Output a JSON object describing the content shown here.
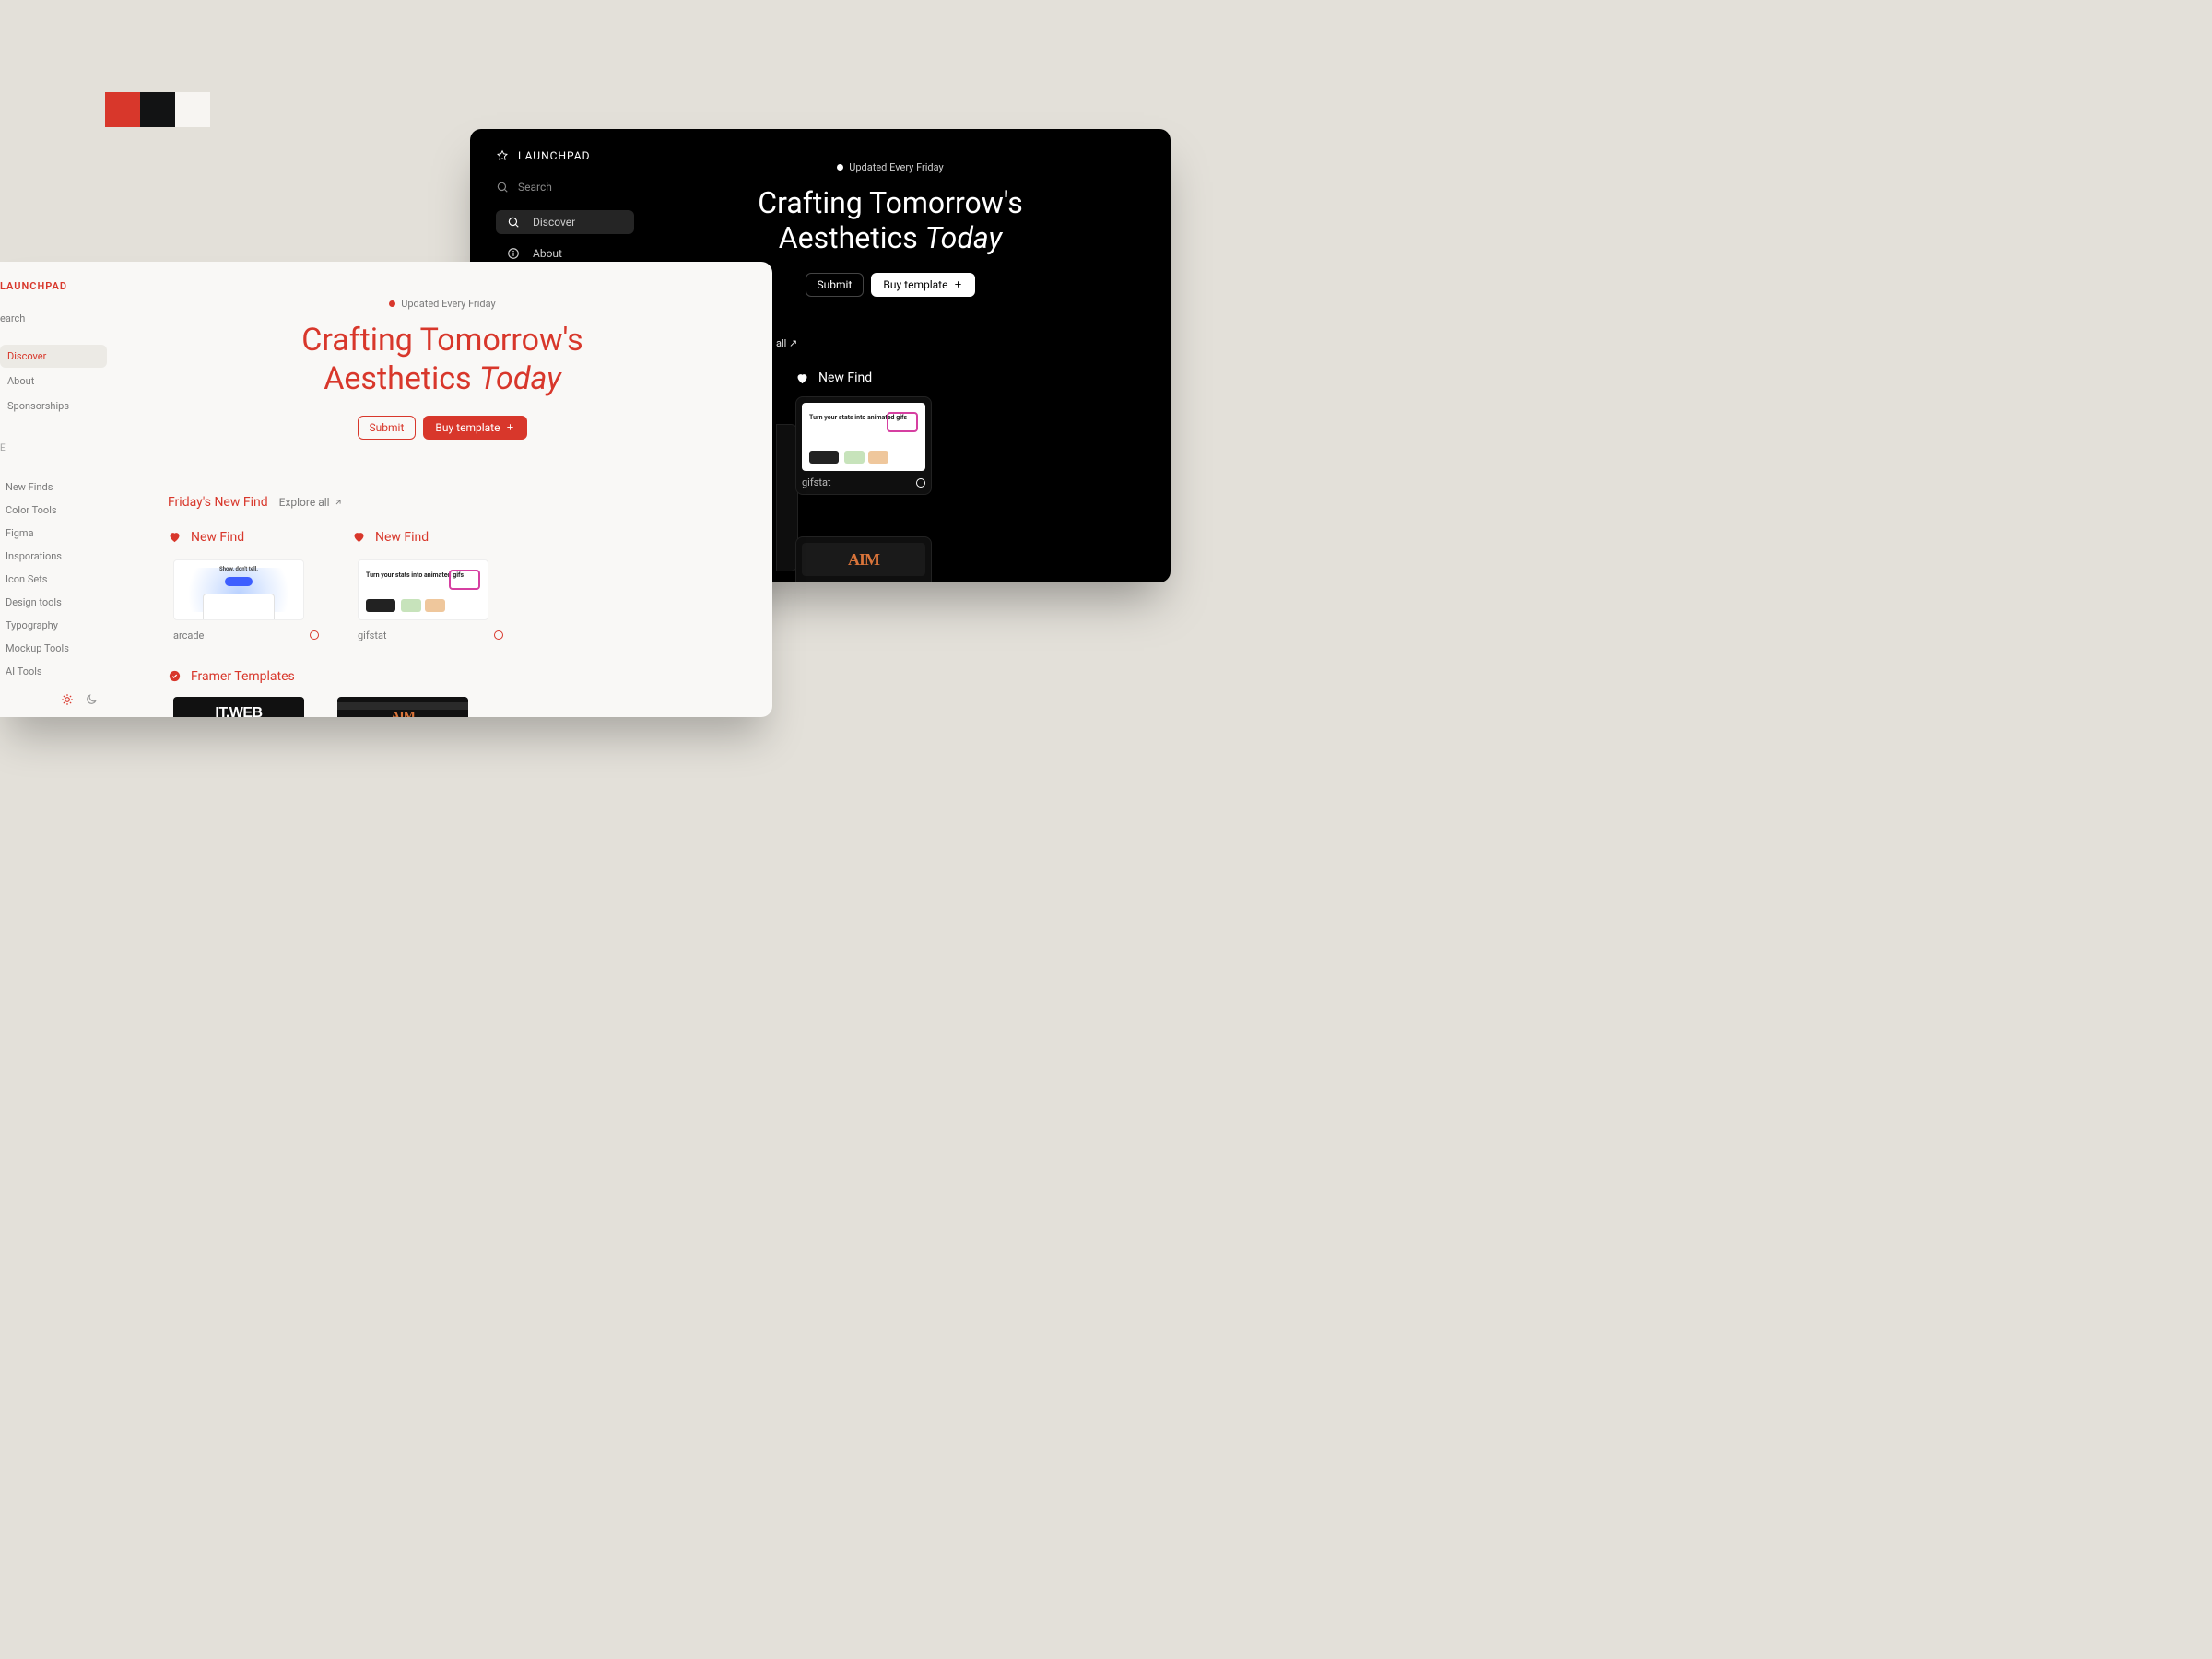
{
  "palette": {
    "red": "#d8372b",
    "black": "#121314",
    "white": "#f7f5f2"
  },
  "brand": "LAUNCHPAD",
  "search_placeholder": "Search",
  "nav": {
    "discover": "Discover",
    "about": "About",
    "sponsorships": "Sponsorships"
  },
  "categories_label": "E",
  "categories": [
    "New Finds",
    "Color Tools",
    "Figma",
    "Insporations",
    "Icon Sets",
    "Design tools",
    "Typography",
    "Mockup Tools",
    "AI Tools"
  ],
  "hero": {
    "update_label": "Updated Every Friday",
    "title_line1": "Crafting Tomorrow's",
    "title_line2_a": "Aesthetics ",
    "title_line2_em": "Today",
    "submit": "Submit",
    "buy": "Buy template"
  },
  "friday": {
    "title": "Friday's New Find",
    "explore": "Explore all",
    "new_find_label": "New Find",
    "cards": [
      {
        "name": "arcade",
        "thumb_text": "Show, don't tell."
      },
      {
        "name": "gifstat",
        "thumb_text": "Turn your stats into animated gifs"
      }
    ]
  },
  "framer": {
    "title": "Framer Templates",
    "tiles": [
      {
        "label": "IT.WEB"
      },
      {
        "label": "AIM"
      }
    ]
  },
  "dark_explore": "all ↗",
  "dark_card_name": "gifstat",
  "dark_second_tile": "AIM",
  "light_search_label": "earch"
}
